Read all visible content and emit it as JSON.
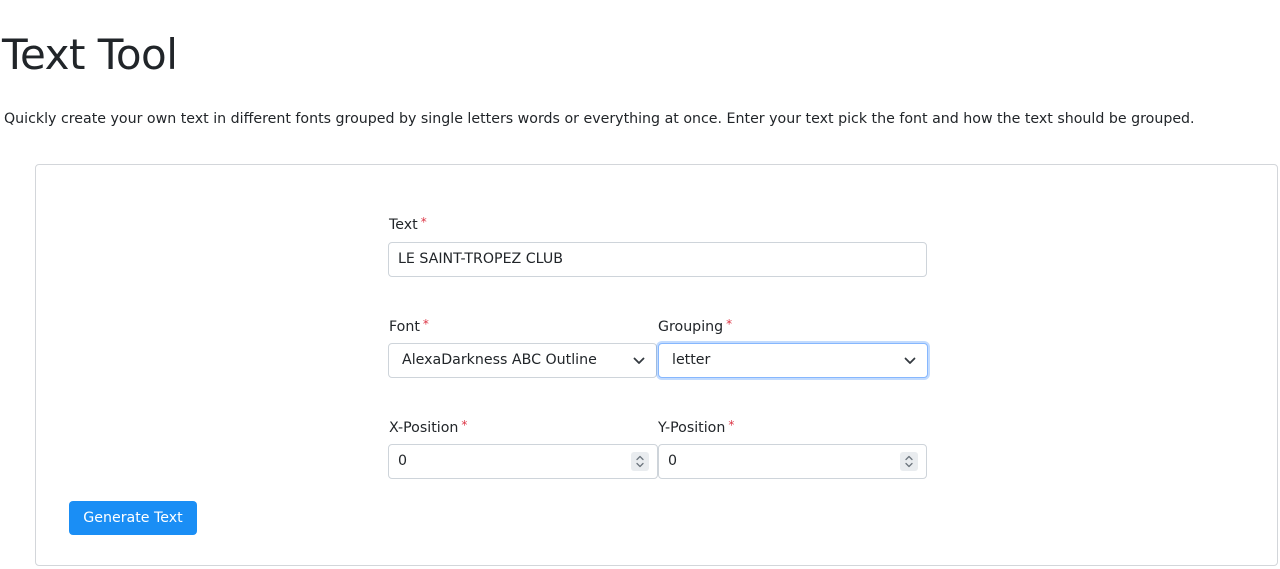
{
  "page": {
    "title": "Text Tool",
    "description": "Quickly create your own text in different fonts grouped by single letters words or everything at once. Enter your text pick the font and how the text should be grouped."
  },
  "form": {
    "required_marker": "*",
    "text": {
      "label": "Text",
      "value": "LE SAINT-TROPEZ CLUB"
    },
    "font": {
      "label": "Font",
      "selected": "AlexaDarkness ABC Outline"
    },
    "grouping": {
      "label": "Grouping",
      "selected": "letter"
    },
    "x_position": {
      "label": "X-Position",
      "value": "0"
    },
    "y_position": {
      "label": "Y-Position",
      "value": "0"
    },
    "submit_label": "Generate Text"
  },
  "icons": {
    "select_arrow": "chevron-down-icon",
    "number_spinner": "spinner-updown-icon"
  },
  "colors": {
    "primary_button": "#1a8ef5",
    "required_marker": "#dc3545",
    "focus_border": "#86b7fe"
  }
}
